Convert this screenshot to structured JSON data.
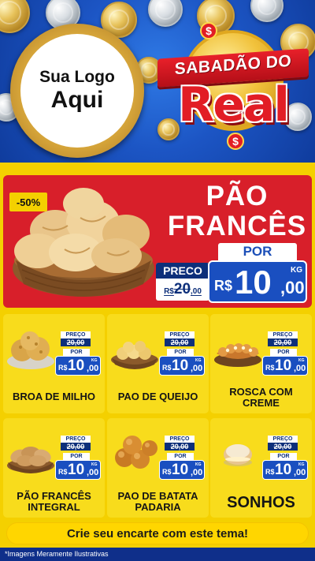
{
  "header": {
    "logo_line1": "Sua Logo",
    "logo_line2": "Aqui",
    "title_line1": "SABADÃO DO",
    "title_line2": "Real",
    "badge_symbol": "$"
  },
  "hero": {
    "discount": "-50%",
    "title_line1": "PÃO",
    "title_line2": "FRANCÊS",
    "old_label": "PRECO",
    "old_currency": "R$",
    "old_int": "20",
    "old_dec": ",00",
    "new_label": "POR",
    "new_currency": "R$",
    "new_int": "10",
    "new_dec": ",00",
    "unit": "KG"
  },
  "products": [
    {
      "name": "BROA DE MILHO",
      "old_label": "PREÇO",
      "old_price": "20,00",
      "new_label": "POR",
      "currency": "R$",
      "int": "10",
      "dec": ",00",
      "unit": "KG"
    },
    {
      "name": "PAO DE QUEIJO",
      "old_label": "PREÇO",
      "old_price": "20,00",
      "new_label": "POR",
      "currency": "R$",
      "int": "10",
      "dec": ",00",
      "unit": "KG"
    },
    {
      "name": "ROSCA COM CREME",
      "old_label": "PREÇO",
      "old_price": "20,00",
      "new_label": "POR",
      "currency": "R$",
      "int": "10",
      "dec": ",00",
      "unit": "KG"
    },
    {
      "name": "PÃO FRANCÊS INTEGRAL",
      "old_label": "PREÇO",
      "old_price": "20,00",
      "new_label": "POR",
      "currency": "R$",
      "int": "10",
      "dec": ",00",
      "unit": "KG"
    },
    {
      "name": "PAO DE BATATA PADARIA",
      "old_label": "PREÇO",
      "old_price": "20,00",
      "new_label": "POR",
      "currency": "R$",
      "int": "10",
      "dec": ",00",
      "unit": "KG"
    },
    {
      "name": "SONHOS",
      "old_label": "PREÇO",
      "old_price": "20,00",
      "new_label": "POR",
      "currency": "R$",
      "int": "10",
      "dec": ",00",
      "unit": "KG"
    }
  ],
  "footer": {
    "cta": "Crie seu encarte com este tema!",
    "disclaimer": "*Imagens Meramente Ilustrativas"
  },
  "colors": {
    "brand_red": "#d81f2a",
    "brand_blue": "#1a4fc0",
    "brand_yellow": "#f4d000"
  }
}
